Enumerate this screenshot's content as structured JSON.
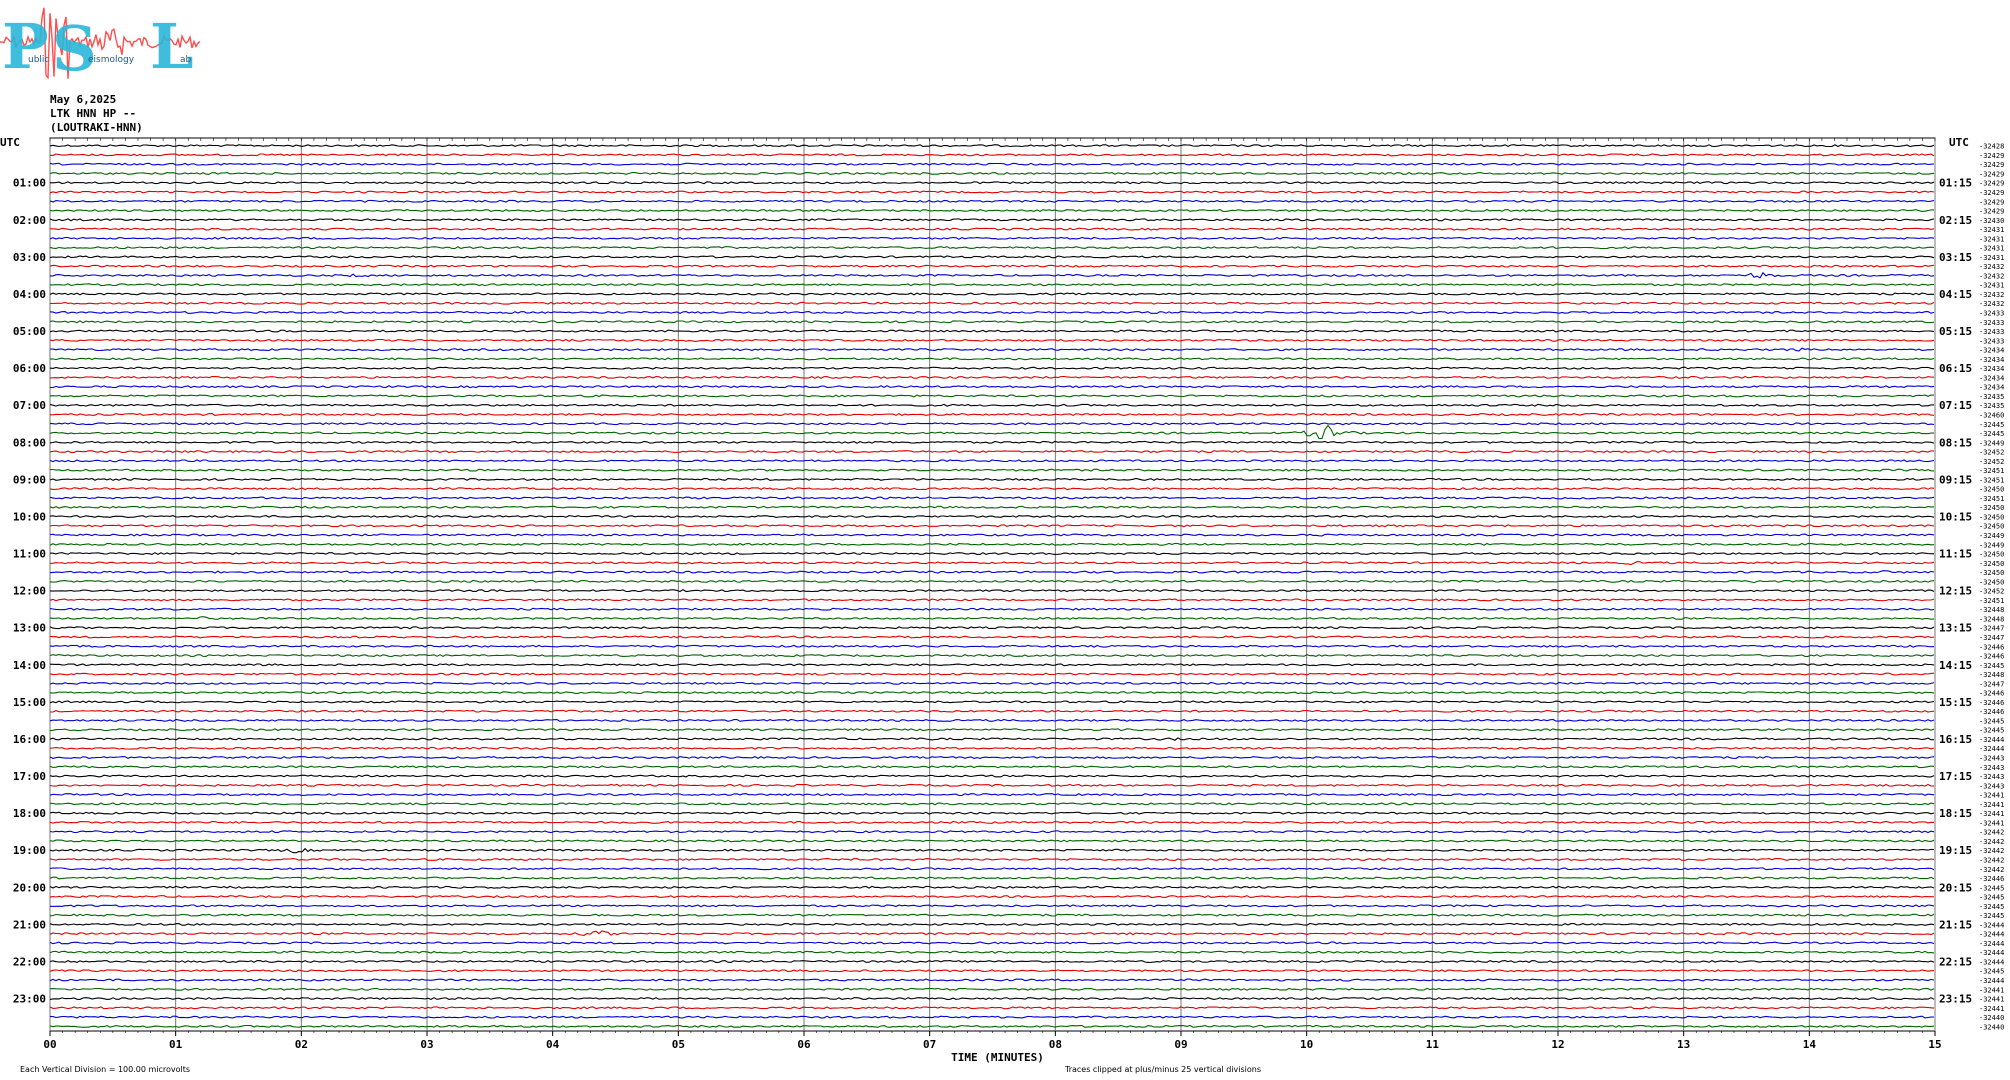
{
  "logo": {
    "letters": [
      "P",
      "S",
      "L"
    ],
    "words": [
      "ublic",
      "eismology",
      "ab"
    ],
    "colors": {
      "letters": "#29b6d8",
      "signal": "#ff4d4d",
      "text": "#1a5a8a"
    }
  },
  "header": {
    "date": "May 6,2025",
    "station": "LTK HNN HP --",
    "location": "(LOUTRAKI-HNN)"
  },
  "chart_data": {
    "type": "line",
    "title": "",
    "xlabel": "TIME (MINUTES)",
    "xlim": [
      0,
      15
    ],
    "x_ticks": [
      "00",
      "01",
      "02",
      "03",
      "04",
      "05",
      "06",
      "07",
      "08",
      "09",
      "10",
      "11",
      "12",
      "13",
      "14",
      "15"
    ],
    "left_axis_title": "UTC",
    "right_axis_title": "UTC",
    "left_hour_labels": [
      "01:00",
      "02:00",
      "03:00",
      "04:00",
      "05:00",
      "06:00",
      "07:00",
      "08:00",
      "09:00",
      "10:00",
      "11:00",
      "12:00",
      "13:00",
      "14:00",
      "15:00",
      "16:00",
      "17:00",
      "18:00",
      "19:00",
      "20:00",
      "21:00",
      "22:00",
      "23:00"
    ],
    "right_hour_labels": [
      "01:15",
      "02:15",
      "03:15",
      "04:15",
      "05:15",
      "06:15",
      "07:15",
      "08:15",
      "09:15",
      "10:15",
      "11:15",
      "12:15",
      "13:15",
      "14:15",
      "15:15",
      "16:15",
      "17:15",
      "18:15",
      "19:15",
      "20:15",
      "21:15",
      "22:15",
      "23:15"
    ],
    "trace_count": 96,
    "trace_colors": [
      "#000000",
      "#e00000",
      "#0000d0",
      "#006400"
    ],
    "trace_offsets": [
      "-32428",
      "-32429",
      "-32429",
      "-32429",
      "-32429",
      "-32429",
      "-32429",
      "-32429",
      "-32430",
      "-32431",
      "-32431",
      "-32431",
      "-32431",
      "-32432",
      "-32432",
      "-32431",
      "-32432",
      "-32432",
      "-32433",
      "-32433",
      "-32433",
      "-32433",
      "-32434",
      "-32434",
      "-32434",
      "-32434",
      "-32434",
      "-32435",
      "-32435",
      "-32460",
      "-32445",
      "-32445",
      "-32449",
      "-32452",
      "-32452",
      "-32451",
      "-32451",
      "-32450",
      "-32451",
      "-32450",
      "-32450",
      "-32450",
      "-32449",
      "-32449",
      "-32450",
      "-32450",
      "-32450",
      "-32450",
      "-32452",
      "-32451",
      "-32448",
      "-32448",
      "-32447",
      "-32447",
      "-32446",
      "-32446",
      "-32445",
      "-32448",
      "-32447",
      "-32446",
      "-32446",
      "-32446",
      "-32445",
      "-32445",
      "-32444",
      "-32444",
      "-32443",
      "-32443",
      "-32443",
      "-32443",
      "-32441",
      "-32441",
      "-32441",
      "-32441",
      "-32442",
      "-32442",
      "-32442",
      "-32442",
      "-32442",
      "-32446",
      "-32445",
      "-32445",
      "-32445",
      "-32445",
      "-32444",
      "-32444",
      "-32444",
      "-32444",
      "-32444",
      "-32445",
      "-32444",
      "-32441",
      "-32441",
      "-32441",
      "-32440",
      "-32440"
    ],
    "events": [
      {
        "trace": 31,
        "minute": 10.15,
        "amplitude": 9
      },
      {
        "trace": 85,
        "minute": 4.35,
        "amplitude": 4
      },
      {
        "trace": 76,
        "minute": 1.95,
        "amplitude": 3
      },
      {
        "trace": 14,
        "minute": 13.6,
        "amplitude": 4
      },
      {
        "trace": 14,
        "minute": 2.45,
        "amplitude": 2
      },
      {
        "trace": 21,
        "minute": 5.1,
        "amplitude": 2
      },
      {
        "trace": 22,
        "minute": 13.9,
        "amplitude": 2
      },
      {
        "trace": 64,
        "minute": 8.9,
        "amplitude": 2
      },
      {
        "trace": 45,
        "minute": 12.6,
        "amplitude": 2
      },
      {
        "trace": 46,
        "minute": 14.6,
        "amplitude": 2
      },
      {
        "trace": 47,
        "minute": 13.6,
        "amplitude": 2
      },
      {
        "trace": 51,
        "minute": 1.2,
        "amplitude": 2
      },
      {
        "trace": 65,
        "minute": 3.9,
        "amplitude": 2
      }
    ],
    "grid": true,
    "footnotes": {
      "left": "Each Vertical Division =  100.00 microvolts",
      "right": "Traces clipped at plus/minus 25 vertical divisions"
    }
  }
}
